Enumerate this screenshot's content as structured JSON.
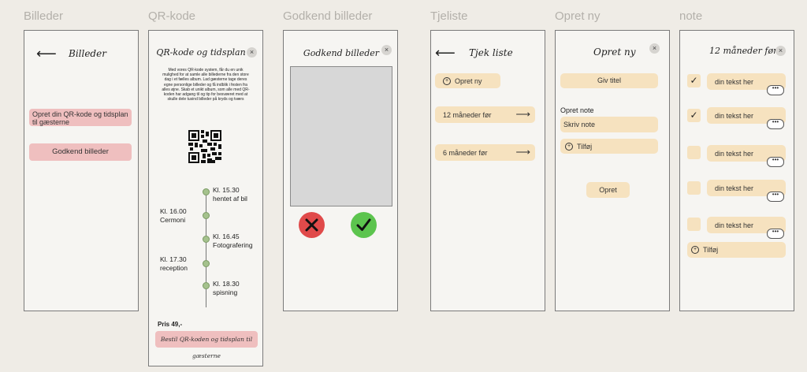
{
  "frames": {
    "billeder": {
      "label": "Billeder",
      "title": "Billeder",
      "back_icon": "arrow-left-icon",
      "btn_qr": "Opret din QR-kode og tidsplan til gæsterne",
      "btn_approve": "Godkend billeder"
    },
    "qr": {
      "label": "QR-kode",
      "title": "QR-kode og tidsplan",
      "close": "×",
      "description": "Med vores QR-kode system, får du en unik mulighed for at samle alle billederne fra den store dag i et fælles album. Lad gæsterne tage deres egne personlige billeder og få indblik i festen fra alles øjne. Skab et unikt album, som alle med QR-koden har adgang til og tip for besvøeret med at skulle dele tusind billeder på kryds og tværs",
      "timeline": [
        {
          "time": "Kl. 15.30",
          "event": "hentet af bil"
        },
        {
          "time": "Kl. 16.00",
          "event": "Cermoni"
        },
        {
          "time": "Kl. 16.45",
          "event": "Fotografering"
        },
        {
          "time": "Kl. 17.30",
          "event": "reception"
        },
        {
          "time": "Kl. 18.30",
          "event": "spisning"
        }
      ],
      "price": "Pris 49,-",
      "order_btn": "Bestil QR-koden og tidsplan til gæsterne"
    },
    "godkend": {
      "label": "Godkend billeder",
      "title": "Godkend billeder",
      "close": "×",
      "reject_icon": "x-icon",
      "accept_icon": "check-icon",
      "reject_color": "#e04a4a",
      "accept_color": "#5cc44e"
    },
    "tjek": {
      "label": "Tjeliste",
      "title": "Tjek liste",
      "new_btn": "Opret ny",
      "items": [
        "12 måneder før",
        "6 måneder før"
      ]
    },
    "opret": {
      "label": "Opret ny",
      "title": "Opret ny",
      "close": "×",
      "title_btn": "Giv titel",
      "note_label": "Opret note",
      "note_placeholder": "Skriv note",
      "add_btn": "Tilføj",
      "create_btn": "Opret"
    },
    "note": {
      "label": "note",
      "title": "12 måneder før",
      "close": "×",
      "rows": [
        {
          "text": "din tekst her",
          "checked": true
        },
        {
          "text": "din tekst her",
          "checked": true
        },
        {
          "text": "din tekst her",
          "checked": false
        },
        {
          "text": "din tekst her",
          "checked": false
        },
        {
          "text": "din tekst her",
          "checked": false
        }
      ],
      "add_btn": "Tilføj",
      "more": "•••",
      "check": "✓"
    }
  }
}
